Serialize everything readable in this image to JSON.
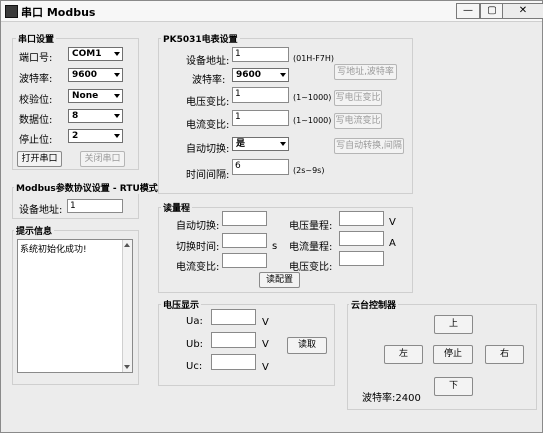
{
  "window": {
    "title": "串口 Modbus",
    "minimize": "—",
    "maximize": "▢",
    "close": "✕"
  },
  "serial": {
    "group_title": "串口设置",
    "port_label": "端口号:",
    "port_value": "COM1",
    "baud_label": "波特率:",
    "baud_value": "9600",
    "parity_label": "校验位:",
    "parity_value": "None",
    "databits_label": "数据位:",
    "databits_value": "8",
    "stopbits_label": "停止位:",
    "stopbits_value": "2",
    "open_button": "打开串口",
    "close_button": "关闭串口"
  },
  "modbus": {
    "group_title": "Modbus参数协议设置 - RTU模式",
    "address_label": "设备地址:",
    "address_value": "1"
  },
  "info": {
    "group_title": "提示信息",
    "text": "系统初始化成功!"
  },
  "pk": {
    "group_title": "PK5031电表设置",
    "addr_label": "设备地址:",
    "addr_value": "1",
    "addr_hint": "(01H-F7H)",
    "baud_label": "波特率:",
    "baud_value": "9600",
    "write_addr_button": "写地址,波特率",
    "pt_label": "电压变比:",
    "pt_value": "1",
    "pt_hint": "(1~1000)",
    "write_pt_button": "写电压变比",
    "ct_label": "电流变比:",
    "ct_value": "1",
    "ct_hint": "(1~1000)",
    "write_ct_button": "写电流变比",
    "auto_label": "自动切换:",
    "auto_value": "是",
    "write_auto_button": "写自动转换,间隔",
    "interval_label": "时间间隔:",
    "interval_value": "6",
    "interval_hint": "(2s~9s)"
  },
  "read": {
    "group_title": "读量程",
    "auto_label": "自动切换:",
    "interval_label": "切换时间:",
    "interval_unit": "s",
    "ct_label": "电流变比:",
    "vrange_label": "电压量程:",
    "vrange_unit": "V",
    "irange_label": "电流量程:",
    "irange_unit": "A",
    "pt_label": "电压变比:",
    "read_button": "读配置"
  },
  "voltage": {
    "group_title": "电压显示",
    "ua_label": "Ua:",
    "ub_label": "Ub:",
    "uc_label": "Uc:",
    "unit": "V",
    "read_button": "读取"
  },
  "ptz": {
    "group_title": "云台控制器",
    "up": "上",
    "left": "左",
    "stop": "停止",
    "right": "右",
    "down": "下",
    "baud_text": "波特率:2400"
  }
}
